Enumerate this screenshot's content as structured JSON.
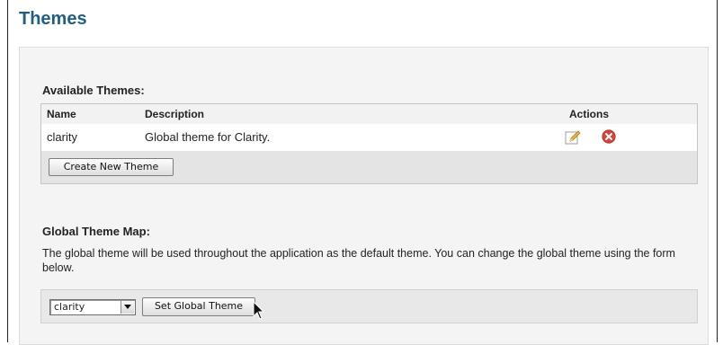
{
  "page": {
    "title": "Themes"
  },
  "available_themes": {
    "heading": "Available Themes:",
    "columns": {
      "name": "Name",
      "description": "Description",
      "actions": "Actions"
    },
    "rows": [
      {
        "name": "clarity",
        "description": "Global theme for Clarity.",
        "actions": [
          "edit-icon",
          "delete-icon"
        ]
      }
    ],
    "create_button": "Create New Theme"
  },
  "global_theme_map": {
    "heading": "Global Theme Map:",
    "description": "The global theme will be used throughout the application as the default theme. You can change the global theme using the form below.",
    "select_value": "clarity",
    "set_button": "Set Global Theme"
  },
  "colors": {
    "title": "#1f5f86",
    "panel_bg": "#f4f4f4",
    "table_footer_bg": "#e4e4e4",
    "delete_icon": "#d9443a",
    "edit_icon": "#e7b63a"
  }
}
